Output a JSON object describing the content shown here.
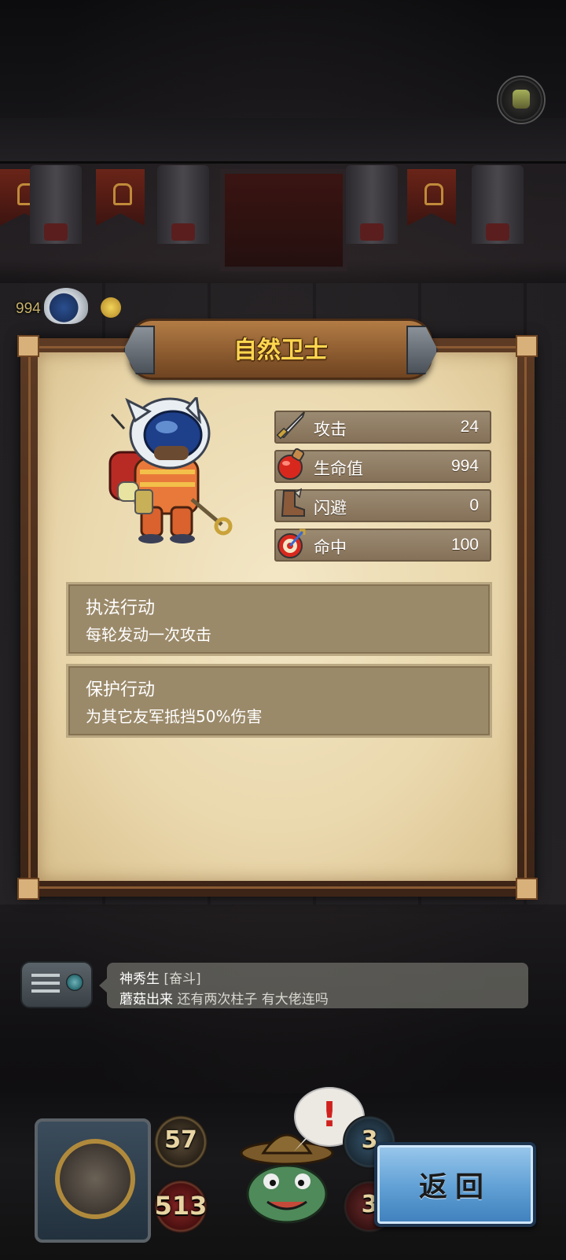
{
  "unit": {
    "name": "自然卫士",
    "map_hp_tag": "994"
  },
  "stats": [
    {
      "icon": "sword-icon",
      "label": "攻击",
      "value": "24"
    },
    {
      "icon": "potion-icon",
      "label": "生命值",
      "value": "994"
    },
    {
      "icon": "boot-icon",
      "label": "闪避",
      "value": "0"
    },
    {
      "icon": "target-icon",
      "label": "命中",
      "value": "100"
    }
  ],
  "skills": [
    {
      "name": "执法行动",
      "desc": "每轮发动一次攻击"
    },
    {
      "name": "保护行动",
      "desc": "为其它友军抵挡50%伤害"
    }
  ],
  "chat": {
    "user": "神秀生",
    "tag": "[奋斗]",
    "message_user": "蘑菇出来",
    "message": "还有两次柱子 有大佬连吗"
  },
  "hud": {
    "attack": "57",
    "hp": "513",
    "right_top": "3",
    "right_bottom": "3",
    "alert_mark": "!",
    "back_label": "返回"
  },
  "colors": {
    "title": "#ffd64f",
    "parchment": "#efe0bb",
    "stat_bar": "#8f7c62",
    "back_button": "#5f9fd4"
  }
}
